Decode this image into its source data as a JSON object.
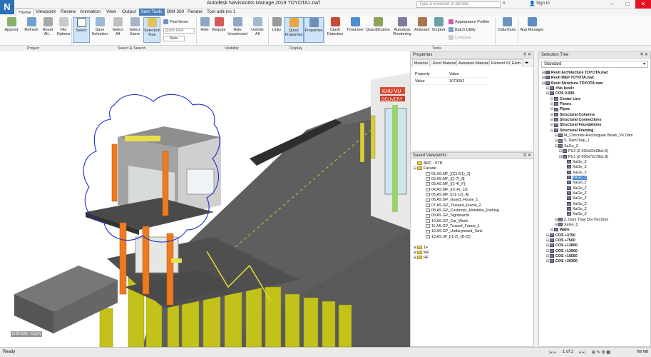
{
  "app": {
    "logo": "N",
    "title": "Autodesk Navisworks Manage 2019    TOYOTA1.nwf",
    "search_placeholder": "Type a keyword or phrase",
    "sign_in": "Sign In"
  },
  "menu": [
    "Home",
    "Viewpoint",
    "Review",
    "Animation",
    "View",
    "Output",
    "Item Tools",
    "BIM 360",
    "Render",
    "Tool add-ins 1"
  ],
  "ribbon": {
    "project": [
      "Append",
      "Refresh",
      "Reset All...",
      "File Options"
    ],
    "select": [
      "Select",
      "Save Selection",
      "Select All",
      "Select Same",
      "Selection Tree"
    ],
    "find_items": "Find Items",
    "quick_find": "Quick Find",
    "sets": "Sets",
    "visibility": [
      "Hide",
      "Require",
      "Hide Unselected",
      "Unhide All"
    ],
    "display": [
      "Links",
      "Quick Properties",
      "Properties"
    ],
    "tools": [
      "Clash Detective",
      "TimeLiner",
      "Quantification",
      "Autodesk Rendering",
      "Animator",
      "Scripter"
    ],
    "tools_small": [
      "Appearance Profiler",
      "Batch Utility",
      "Compare"
    ],
    "datatools": "DataTools",
    "appmgr": "App Manager",
    "groups": [
      "Project",
      "Select & Search",
      "Visibility",
      "Display",
      "Tools"
    ]
  },
  "viewport": {
    "view_label": "0.00-183 - Gz(4)",
    "sign_text_1": "KHU VU",
    "sign_text_2": "DELIVERY"
  },
  "properties": {
    "title": "Properties",
    "tabs": [
      "Material",
      "Revit Material",
      "Autodesk Material",
      "Element ID",
      "Elem"
    ],
    "col_property": "Property",
    "col_value": "Value",
    "row_property": "Value",
    "row_value": "1073692"
  },
  "viewpoints": {
    "title": "Saved Viewpoints",
    "items": [
      {
        "t": "ARC - STR",
        "lvl": 0,
        "k": "v"
      },
      {
        "t": "Facade",
        "lvl": 0,
        "k": "f"
      },
      {
        "t": "01.AS.MF_[(C1-D1)_1]",
        "lvl": 2,
        "k": "v"
      },
      {
        "t": "02.AS.MF_[(1-7)_8]",
        "lvl": 2,
        "k": "v"
      },
      {
        "t": "03.AS.MF_[(1-4)_F]",
        "lvl": 2,
        "k": "v"
      },
      {
        "t": "04.AS.MF_[(C-F)_12]",
        "lvl": 2,
        "k": "v"
      },
      {
        "t": "05.AS.MF_[(11-12)_A]",
        "lvl": 2,
        "k": "v"
      },
      {
        "t": "06.AS.GP_Guard_House_1",
        "lvl": 2,
        "k": "v"
      },
      {
        "t": "07.AS.GP_Trussed_Frame_2",
        "lvl": 2,
        "k": "v"
      },
      {
        "t": "08.AS.GP_Customer_Motobike_Parking",
        "lvl": 2,
        "k": "v"
      },
      {
        "t": "09.AS.GP_Signboards",
        "lvl": 2,
        "k": "v"
      },
      {
        "t": "10.AS.GP_Car_Wash",
        "lvl": 2,
        "k": "v"
      },
      {
        "t": "11.AS.GP_Trussef_Frame_1",
        "lvl": 2,
        "k": "v"
      },
      {
        "t": "12.AS.GP_Underground_Tank",
        "lvl": 2,
        "k": "v"
      },
      {
        "t": "13.AS.3F_[(1-2)_(B-C)]",
        "lvl": 2,
        "k": "v"
      },
      {
        "t": "",
        "lvl": 0,
        "k": "b"
      },
      {
        "t": "1F",
        "lvl": 0,
        "k": "f"
      },
      {
        "t": "MF",
        "lvl": 0,
        "k": "f"
      },
      {
        "t": "RF",
        "lvl": 0,
        "k": "f"
      }
    ]
  },
  "selection_tree": {
    "title": "Selection Tree",
    "mode": "Standard",
    "items": [
      {
        "t": "Revit Architecture TOYOTA.nwc",
        "lvl": 0
      },
      {
        "t": "Revit MEP TOYOTA.nwc",
        "lvl": 0
      },
      {
        "t": "Revit Structure TOYOTA.nwc",
        "lvl": 0
      },
      {
        "t": "<No level>",
        "lvl": 1
      },
      {
        "t": "COS 0.000",
        "lvl": 1
      },
      {
        "t": "Center Line",
        "lvl": 2
      },
      {
        "t": "Floors",
        "lvl": 2
      },
      {
        "t": "Pipes",
        "lvl": 2
      },
      {
        "t": "Structural Columns",
        "lvl": 2
      },
      {
        "t": "Structural Connections",
        "lvl": 2
      },
      {
        "t": "Structural Foundations",
        "lvl": 2
      },
      {
        "t": "Structural Framing",
        "lvl": 2
      },
      {
        "t": "M_Concrete-Rectangular Beam_Vê Dầm",
        "lvl": 3
      },
      {
        "t": "S. DamThep_1",
        "lvl": 3
      },
      {
        "t": "XaGo_Z",
        "lvl": 3
      },
      {
        "t": "PU2 (Z-200x62x68x1.6)",
        "lvl": 4
      },
      {
        "t": "PU1 (Z-300x72x78x1.8)",
        "lvl": 4
      },
      {
        "t": "XaGo_Z",
        "lvl": 5
      },
      {
        "t": "XaGo_Z",
        "lvl": 5
      },
      {
        "t": "XaGo_Z",
        "lvl": 5
      },
      {
        "t": "XaGo_Z",
        "lvl": 5,
        "sel": true
      },
      {
        "t": "XaGo_Z",
        "lvl": 5
      },
      {
        "t": "XaGo_Z",
        "lvl": 5
      },
      {
        "t": "XaGo_Z",
        "lvl": 5
      },
      {
        "t": "XaGo_Z",
        "lvl": 5
      },
      {
        "t": "XaGo_Z",
        "lvl": 5
      },
      {
        "t": "XaGo_Z",
        "lvl": 5
      },
      {
        "t": "XaGo_Z",
        "lvl": 5
      },
      {
        "t": "Z. Dam Thay Doi Tiet Dien",
        "lvl": 3
      },
      {
        "t": "XaGo_C",
        "lvl": 3
      },
      {
        "t": "Walls",
        "lvl": 2
      },
      {
        "t": "COS +3750",
        "lvl": 1
      },
      {
        "t": "COS +7500",
        "lvl": 1
      },
      {
        "t": "COS +12800",
        "lvl": 1
      },
      {
        "t": "COS +13900",
        "lvl": 1
      },
      {
        "t": "COS +16550",
        "lvl": 1
      },
      {
        "t": "COS +20300",
        "lvl": 1
      }
    ]
  },
  "status": {
    "left": "Ready",
    "page": "1 of 1",
    "mem": "766 MB"
  }
}
